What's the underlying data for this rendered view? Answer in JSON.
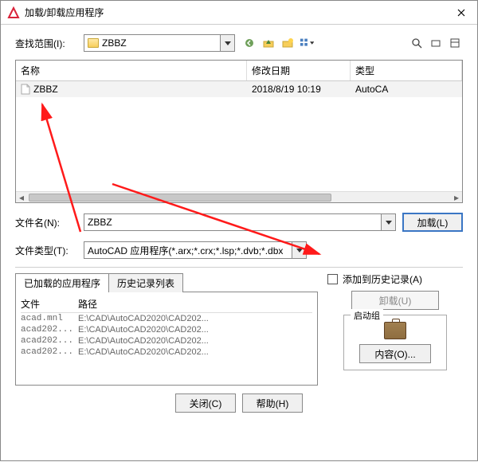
{
  "title": "加载/卸载应用程序",
  "lookin_label": "查找范围(I):",
  "folder_name": "ZBBZ",
  "columns": {
    "name": "名称",
    "date": "修改日期",
    "type": "类型"
  },
  "file_row": {
    "name": "ZBBZ",
    "date": "2018/8/19 10:19",
    "type": "AutoCA"
  },
  "filename_label": "文件名(N):",
  "filename_value": "ZBBZ",
  "filetype_label": "文件类型(T):",
  "filetype_value": "AutoCAD 应用程序(*.arx;*.crx;*.lsp;*.dvb;*.dbx",
  "load_btn": "加载(L)",
  "tabs": {
    "loaded": "已加载的应用程序",
    "history": "历史记录列表"
  },
  "loaded_head": {
    "file": "文件",
    "path": "路径"
  },
  "loaded_items": [
    {
      "file": "acad.mnl",
      "path": "E:\\CAD\\AutoCAD2020\\CAD202..."
    },
    {
      "file": "acad202...",
      "path": "E:\\CAD\\AutoCAD2020\\CAD202..."
    },
    {
      "file": "acad202...",
      "path": "E:\\CAD\\AutoCAD2020\\CAD202..."
    },
    {
      "file": "acad202...",
      "path": "E:\\CAD\\AutoCAD2020\\CAD202..."
    }
  ],
  "add_history_label": "添加到历史记录(A)",
  "unload_btn": "卸载(U)",
  "startup_group": "启动组",
  "contents_btn": "内容(O)...",
  "close_btn": "关闭(C)",
  "help_btn": "帮助(H)"
}
